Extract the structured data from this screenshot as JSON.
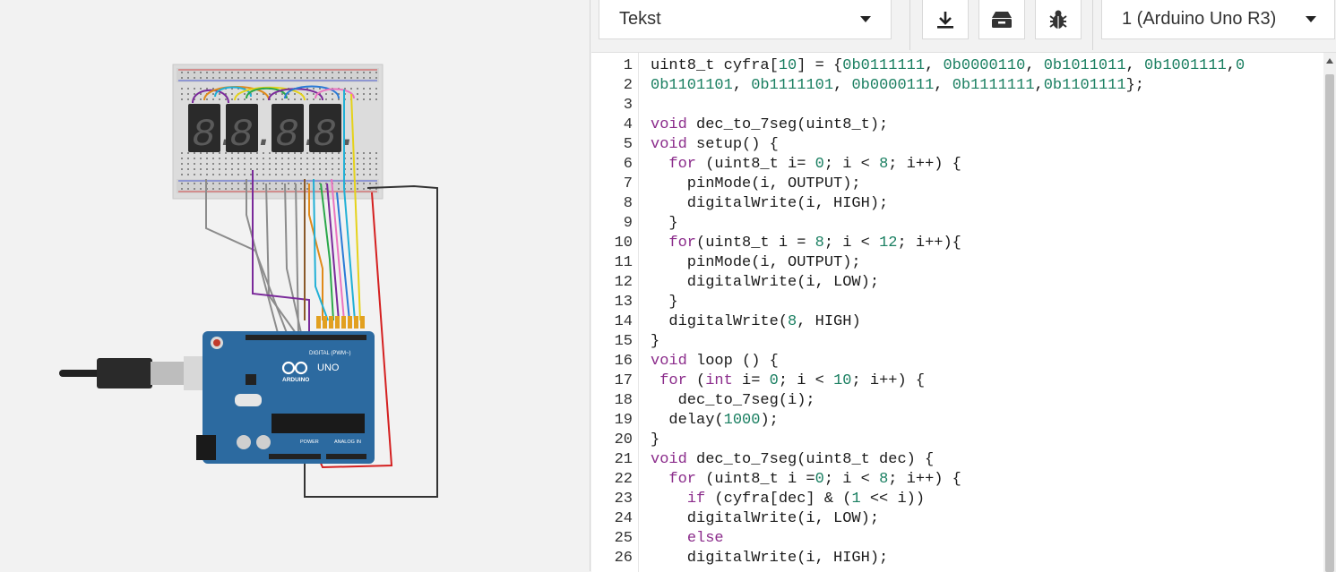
{
  "toolbar": {
    "mode_select": "Tekst",
    "download_icon": "download-icon",
    "library_icon": "components-box-icon",
    "debug_icon": "bug-icon",
    "device_select": "1 (Arduino Uno R3)"
  },
  "circuit": {
    "board_name": "UNO",
    "board_brand": "ARDUINO",
    "digital_label": "DIGITAL (PWM~)",
    "power_label": "POWER",
    "analog_label": "ANALOG IN",
    "display_glyph": "8."
  },
  "editor": {
    "line_numbers": [
      "1",
      "2",
      "3",
      "4",
      "5",
      "6",
      "7",
      "8",
      "9",
      "10",
      "11",
      "12",
      "13",
      "14",
      "15",
      "16",
      "17",
      "18",
      "19",
      "20",
      "21",
      "22",
      "23",
      "24",
      "25",
      "26"
    ],
    "lines": [
      "uint8_t cyfra[10] = {0b0111111, 0b0000110, 0b1011011, 0b1001111,0",
      "0b1101101, 0b1111101, 0b0000111, 0b1111111,0b1101111};",
      "",
      "void dec_to_7seg(uint8_t);",
      "void setup() {",
      "  for (uint8_t i= 0; i < 8; i++) {",
      "    pinMode(i, OUTPUT);",
      "    digitalWrite(i, HIGH);",
      "  }",
      "  for(uint8_t i = 8; i < 12; i++){",
      "    pinMode(i, OUTPUT);",
      "    digitalWrite(i, LOW);",
      "  }",
      "  digitalWrite(8, HIGH)",
      "}",
      "void loop () {",
      " for (int i= 0; i < 10; i++) {",
      "   dec_to_7seg(i);",
      "  delay(1000);",
      "}",
      "void dec_to_7seg(uint8_t dec) {",
      "  for (uint8_t i =0; i < 8; i++) {",
      "    if (cyfra[dec] & (1 << i))",
      "    digitalWrite(i, LOW);",
      "    else",
      "    digitalWrite(i, HIGH);"
    ]
  }
}
